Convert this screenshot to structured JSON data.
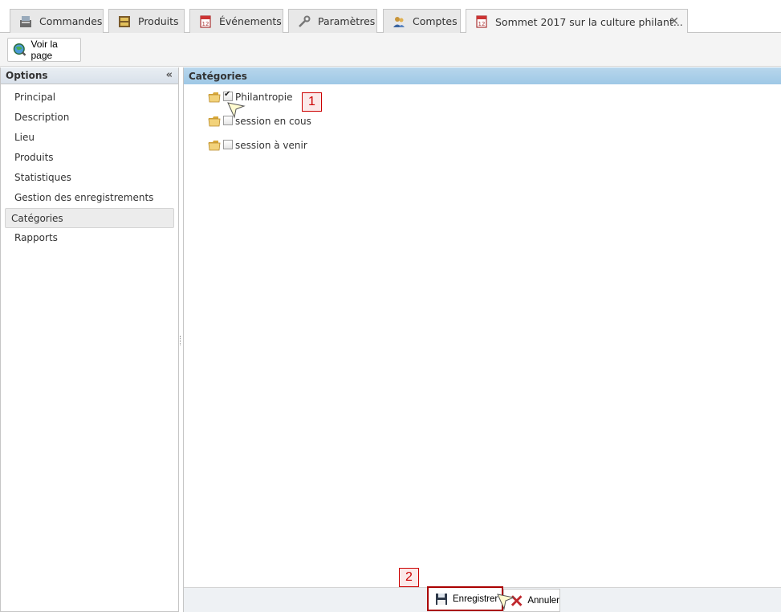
{
  "tabs": [
    {
      "label": "Commandes",
      "icon": "register-icon"
    },
    {
      "label": "Produits",
      "icon": "products-icon"
    },
    {
      "label": "Événements",
      "icon": "calendar-icon"
    },
    {
      "label": "Paramètres",
      "icon": "wrench-icon"
    },
    {
      "label": "Comptes",
      "icon": "accounts-icon"
    },
    {
      "label": "Sommet 2017 sur la culture philant...",
      "icon": "calendar-icon",
      "active": true
    }
  ],
  "toolbar": {
    "view_page_label": "Voir la page"
  },
  "options_panel": {
    "title": "Options",
    "items": [
      "Principal",
      "Description",
      "Lieu",
      "Produits",
      "Statistiques",
      "Gestion des enregistrements",
      "Catégories",
      "Rapports"
    ],
    "selected": "Catégories"
  },
  "categories_panel": {
    "title": "Catégories",
    "nodes": [
      {
        "label": "Philantropie",
        "checked": true
      },
      {
        "label": "session en cous",
        "checked": false
      },
      {
        "label": "session à venir",
        "checked": false
      }
    ]
  },
  "markers": {
    "m1": "1",
    "m2": "2"
  },
  "footer": {
    "save_label": "Enregistrer",
    "cancel_label": "Annuler"
  },
  "colors": {
    "header_blue": "#9ec8e6",
    "marker_red": "#cc0000"
  }
}
